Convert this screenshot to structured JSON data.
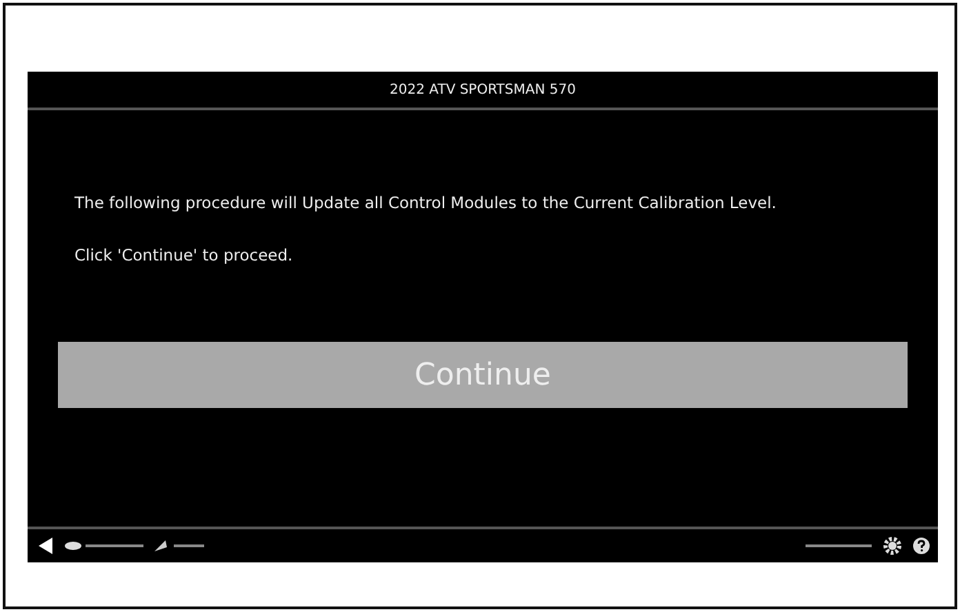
{
  "header": {
    "title": "2022 ATV SPORTSMAN 570"
  },
  "message": {
    "lines": [
      "The following procedure will Update all Control Modules to the Current Calibration Level.",
      "Click 'Continue' to proceed."
    ]
  },
  "continue_button": {
    "label": "Continue",
    "disabled": false
  }
}
